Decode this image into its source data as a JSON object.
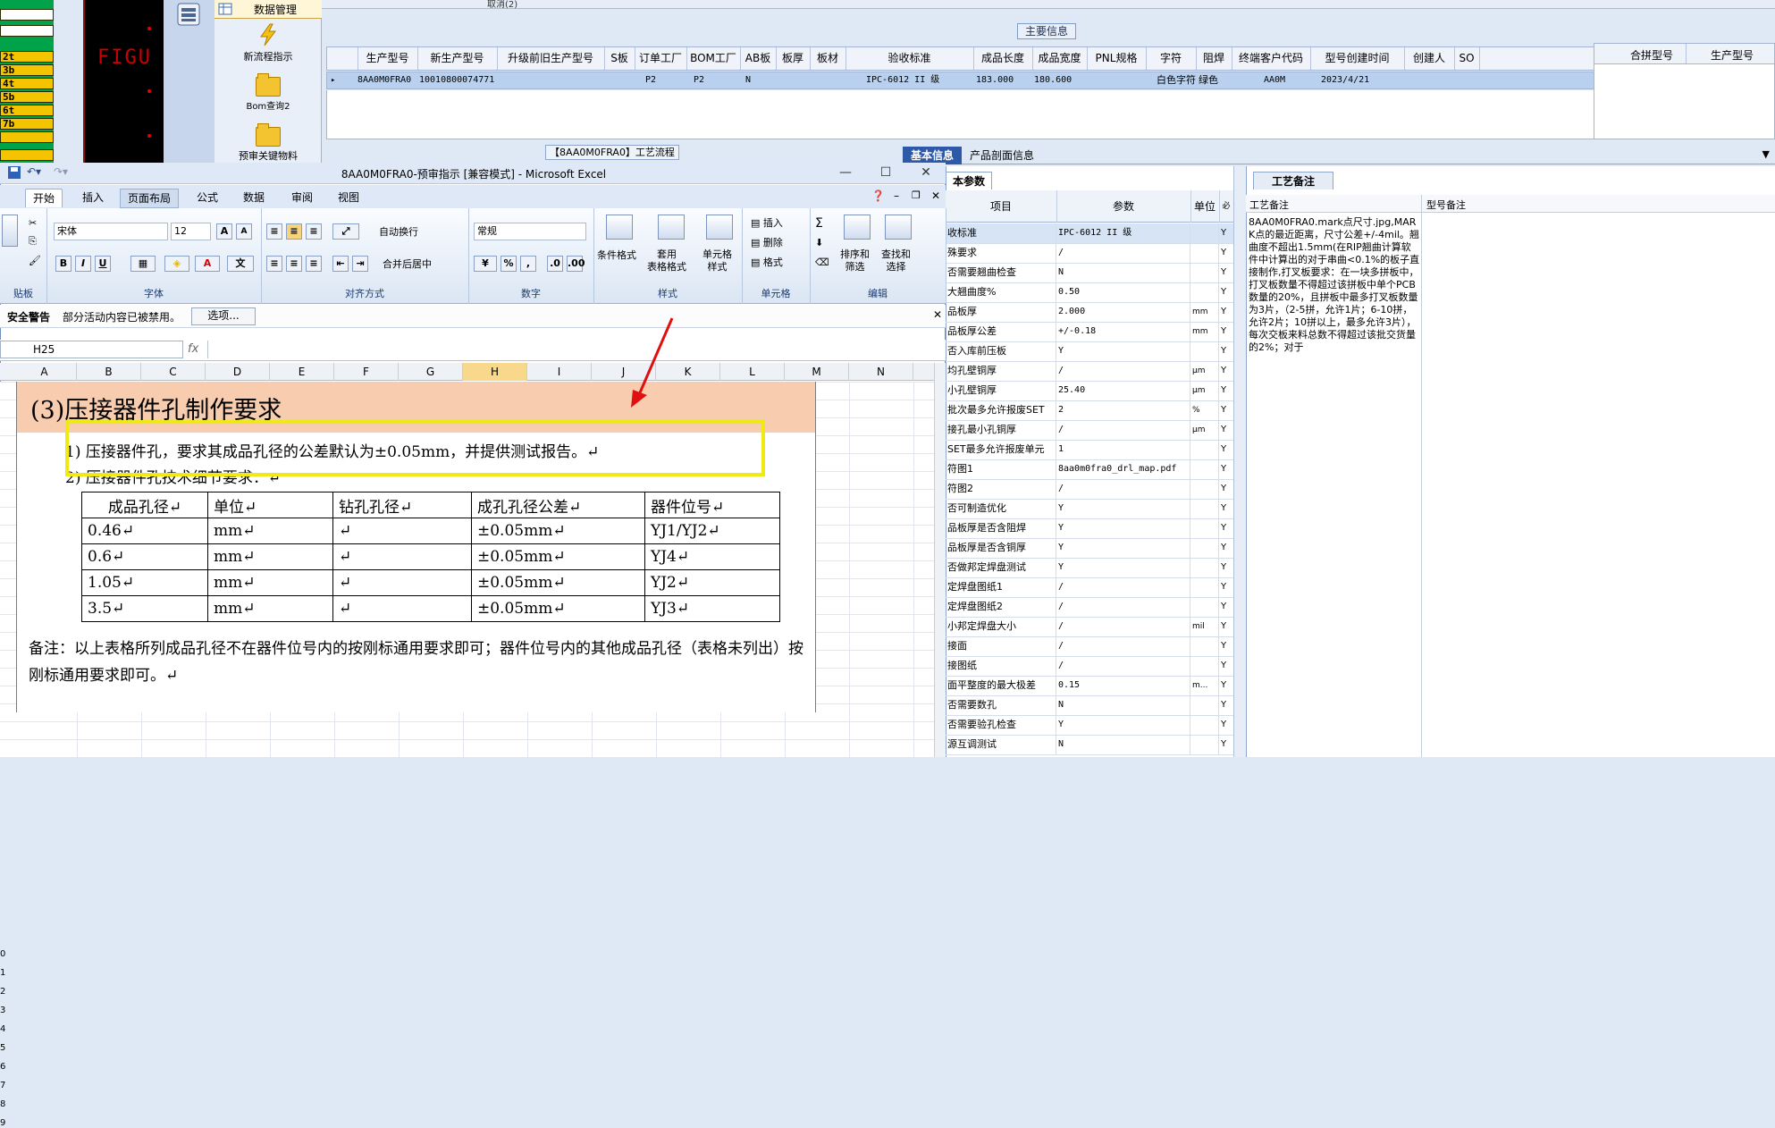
{
  "left_codes": [
    "2t",
    "3b",
    "4t",
    "5b",
    "6t",
    "7b"
  ],
  "fig_label": "FIGU",
  "nav": {
    "title": "数据管理",
    "items": [
      "新流程指示",
      "Bom查询2",
      "预审关键物料"
    ]
  },
  "top_strip_text": "取消(2)",
  "main_info": {
    "title": "主要信息",
    "columns": [
      "生产型号",
      "新生产型号",
      "升级前旧生产型号",
      "S板",
      "订单工厂",
      "BOM工厂",
      "AB板",
      "板厚",
      "板材",
      "验收标准",
      "成品长度",
      "成品宽度",
      "PNL规格",
      "字符",
      "阻焊",
      "终端客户代码",
      "型号创建时间",
      "创建人",
      "SO"
    ],
    "row": [
      "8AA0M0FRA0",
      "10010800074771",
      "",
      "",
      "P2",
      "P2",
      "N",
      "",
      "",
      "IPC-6012 II 级",
      "183.000",
      "180.600",
      "",
      "白色字符",
      "绿色",
      "AA0M",
      "2023/4/21",
      "",
      ""
    ]
  },
  "merge_columns": [
    "合拼型号",
    "生产型号"
  ],
  "flow_tab": "【8AA0M0FRA0】工艺流程",
  "tabs": [
    "基本信息",
    "产品剖面信息"
  ],
  "param_panel": {
    "tab": "本参数",
    "headers": [
      "项目",
      "参数",
      "单位",
      "必"
    ],
    "rows": [
      [
        "收标准",
        "IPC-6012 II 级",
        "",
        "Y"
      ],
      [
        "殊要求",
        "/",
        "",
        "Y"
      ],
      [
        "否需要翘曲检查",
        "N",
        "",
        "Y"
      ],
      [
        "大翘曲度%",
        "0.50",
        "",
        "Y"
      ],
      [
        "品板厚",
        "2.000",
        "mm",
        "Y"
      ],
      [
        "品板厚公差",
        "+/-0.18",
        "mm",
        "Y"
      ],
      [
        "否入库前压板",
        "Y",
        "",
        "Y"
      ],
      [
        "均孔壁铜厚",
        "/",
        "μm",
        "Y"
      ],
      [
        "小孔壁铜厚",
        "25.40",
        "μm",
        "Y"
      ],
      [
        "批次最多允许报废SET",
        "2",
        "%",
        "Y"
      ],
      [
        "接孔最小孔铜厚",
        "/",
        "μm",
        "Y"
      ],
      [
        "SET最多允许报废单元",
        "1",
        "",
        "Y"
      ],
      [
        "符图1",
        "8aa0m0fra0_drl_map.pdf",
        "",
        "Y"
      ],
      [
        "符图2",
        "/",
        "",
        "Y"
      ],
      [
        "否可制造优化",
        "Y",
        "",
        "Y"
      ],
      [
        "品板厚是否含阻焊",
        "Y",
        "",
        "Y"
      ],
      [
        "品板厚是否含铜厚",
        "Y",
        "",
        "Y"
      ],
      [
        "否做邦定焊盘测试",
        "Y",
        "",
        "Y"
      ],
      [
        "定焊盘图纸1",
        "/",
        "",
        "Y"
      ],
      [
        "定焊盘图纸2",
        "/",
        "",
        "Y"
      ],
      [
        "小邦定焊盘大小",
        "/",
        "mil",
        "Y"
      ],
      [
        "接面",
        "/",
        "",
        "Y"
      ],
      [
        "接图纸",
        "/",
        "",
        "Y"
      ],
      [
        "面平整度的最大极差",
        "0.15",
        "m...",
        "Y"
      ],
      [
        "否需要数孔",
        "N",
        "",
        "Y"
      ],
      [
        "否需要验孔检查",
        "Y",
        "",
        "Y"
      ],
      [
        "源互调测试",
        "N",
        "",
        "Y"
      ]
    ]
  },
  "note_panel": {
    "tab": "工艺备注",
    "headers": [
      "工艺备注",
      "型号备注"
    ],
    "text": "8AA0M0FRA0.mark点尺寸.jpg,MARK点的最近距离，尺寸公差+/-4mil。翘曲度不超出1.5mm(在RIP翘曲计算软件中计算出的对于串曲<0.1%的板子直接制作,打叉板要求：在一块多拼板中，打叉板数量不得超过该拼板中单个PCB数量的20%，且拼板中最多打叉板数量为3片，（2-5拼，允许1片；6-10拼，允许2片；10拼以上，最多允许3片），每次交板来料总数不得超过该批交货量的2%；对于"
  },
  "excel": {
    "title": "8AA0M0FRA0-预审指示  [兼容模式] - Microsoft Excel",
    "ribbon_tabs": [
      "开始",
      "插入",
      "页面布局",
      "公式",
      "数据",
      "审阅",
      "视图"
    ],
    "font_name": "宋体",
    "font_size": "12",
    "number_format": "常规",
    "wrap_text": "自动换行",
    "merge_center": "合并后居中",
    "groups": [
      "贴板",
      "字体",
      "对齐方式",
      "数字",
      "样式",
      "单元格",
      "编辑"
    ],
    "cond_format": "条件格式",
    "table_format": "套用\n表格格式",
    "cell_style": "单元格\n样式",
    "insert": "插入",
    "delete": "删除",
    "format": "格式",
    "sort_filter": "排序和\n筛选",
    "find_select": "查找和\n选择",
    "security_label": "安全警告",
    "security_msg": "部分活动内容已被禁用。",
    "options_btn": "选项...",
    "name_box": "H25",
    "fx": "fx",
    "columns": [
      "A",
      "B",
      "C",
      "D",
      "E",
      "F",
      "G",
      "H",
      "I",
      "J",
      "K",
      "L",
      "M",
      "N"
    ],
    "rows_visible": [
      "0",
      "1",
      "2",
      "3",
      "4",
      "5",
      "6",
      "7",
      "8",
      "9"
    ]
  },
  "doc": {
    "heading": "(3)压接器件孔制作要求",
    "req1": "1) 压接器件孔，要求其成品孔径的公差默认为±0.05mm，并提供测试报告。↵",
    "req2": "2) 压接器件孔技术细节要求：↵",
    "table_headers": [
      "成品孔径↵",
      "单位↵",
      "钻孔孔径↵",
      "成孔孔径公差↵",
      "器件位号↵"
    ],
    "table_rows": [
      [
        "0.46↵",
        "mm↵",
        "↵",
        "±0.05mm↵",
        "YJ1/YJ2↵"
      ],
      [
        "0.6↵",
        "mm↵",
        "↵",
        "±0.05mm↵",
        "YJ4↵"
      ],
      [
        "1.05↵",
        "mm↵",
        "↵",
        "±0.05mm↵",
        "YJ2↵"
      ],
      [
        "3.5↵",
        "mm↵",
        "↵",
        "±0.05mm↵",
        "YJ3↵"
      ]
    ],
    "note": "备注：以上表格所列成品孔径不在器件位号内的按刚标通用要求即可；器件位号内的其他成品孔径（表格未列出）按刚标通用要求即可。↵"
  },
  "colors": {
    "accent": "#2e58a8",
    "highlight": "#f0ea14",
    "band": "#f7ccaf",
    "arrow": "#e01010",
    "selected_row": "#b9d1ee"
  }
}
